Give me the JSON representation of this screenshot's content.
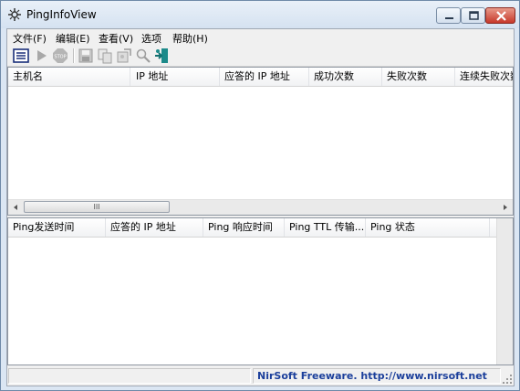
{
  "window": {
    "title": "PingInfoView"
  },
  "menu": [
    "文件(F)",
    "编辑(E)",
    "查看(V)",
    "选项",
    "帮助(H)"
  ],
  "toolbar": {
    "buttons": [
      {
        "name": "properties-icon"
      },
      {
        "name": "start-icon"
      },
      {
        "name": "stop-icon"
      },
      {
        "name": "save-icon"
      },
      {
        "name": "copy-icon"
      },
      {
        "name": "html-report-icon"
      },
      {
        "name": "find-icon"
      },
      {
        "name": "exit-icon"
      }
    ]
  },
  "top_table": {
    "columns": [
      "主机名",
      "IP 地址",
      "应答的 IP 地址",
      "成功次数",
      "失败次数",
      "连续失败次数"
    ],
    "rows": []
  },
  "bottom_table": {
    "columns": [
      "Ping发送时间",
      "应答的 IP 地址",
      "Ping 响应时间",
      "Ping TTL 传输...",
      "Ping 状态"
    ],
    "rows": []
  },
  "scrollbar": {
    "thumb_glyph": "III"
  },
  "status": {
    "credit": "NirSoft Freeware.  http://www.nirsoft.net"
  },
  "colors": {
    "link": "#1b3f9b",
    "close_button": "#c7382a"
  }
}
